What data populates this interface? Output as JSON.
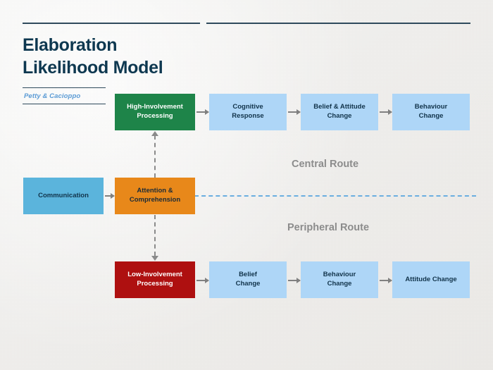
{
  "slide": {
    "title_line1": "Elaboration",
    "title_line2": "Likelihood Model",
    "author": "Petty & Cacioppo",
    "background_color": "#f2f2f0",
    "title_color": "#0e3850",
    "author_color": "#5b9bd5"
  },
  "routes": {
    "central_label": "Central Route",
    "peripheral_label": "Peripheral Route",
    "label_color": "#8c8c8c",
    "divider_color": "#6aaee0",
    "divider_style": "dashed"
  },
  "nodes": {
    "communication": {
      "label": "Communication",
      "color": "#5bb4dc",
      "text_color": "#11334a"
    },
    "attention": {
      "line1": "Attention &",
      "line2": "Comprehension",
      "color": "#e8881a",
      "text_color": "#1c2b36"
    },
    "high_involvement": {
      "line1": "High-Involvement",
      "line2": "Processing",
      "color": "#1e8449",
      "text_color": "#ffffff"
    },
    "low_involvement": {
      "line1": "Low-Involvement",
      "line2": "Processing",
      "color": "#ae1010",
      "text_color": "#ffffff"
    },
    "cognitive_response": {
      "line1": "Cognitive",
      "line2": "Response",
      "color": "#aed6f7",
      "text_color": "#11334a"
    },
    "belief_attitude_change": {
      "line1": "Belief & Attitude",
      "line2": "Change",
      "color": "#aed6f7",
      "text_color": "#11334a"
    },
    "behaviour_change_central": {
      "line1": "Behaviour",
      "line2": "Change",
      "color": "#aed6f7",
      "text_color": "#11334a"
    },
    "belief_change": {
      "line1": "Belief",
      "line2": "Change",
      "color": "#aed6f7",
      "text_color": "#11334a"
    },
    "behaviour_change_peripheral": {
      "line1": "Behaviour",
      "line2": "Change",
      "color": "#aed6f7",
      "text_color": "#11334a"
    },
    "attitude_change": {
      "label": "Attitude Change",
      "color": "#aed6f7",
      "text_color": "#11334a"
    }
  },
  "connectors": {
    "arrow_color": "#808080",
    "dashed_connector_color": "#8a8a8a"
  }
}
